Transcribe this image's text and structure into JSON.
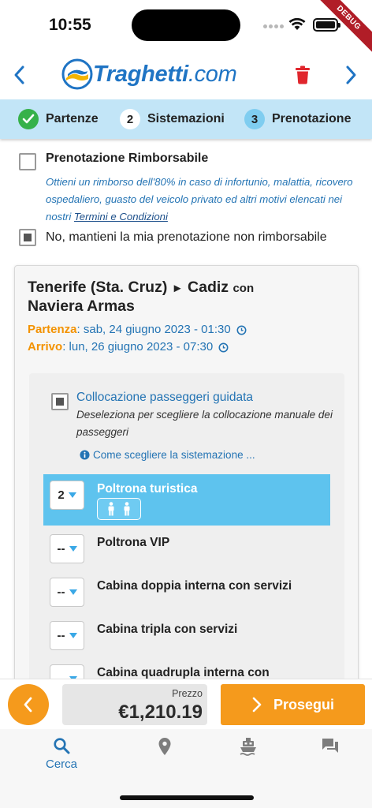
{
  "status_bar": {
    "time": "10:55",
    "debug_label": "DEBUG"
  },
  "header": {
    "logo_main": "Traghetti",
    "logo_suffix": ".com",
    "icons": [
      "chevron-left-icon",
      "trash-icon",
      "chevron-right-icon"
    ],
    "accent_color": "#1f74c4",
    "trash_color": "#e0262d"
  },
  "steps": [
    {
      "number": "",
      "label": "Partenze",
      "state": "done"
    },
    {
      "number": "2",
      "label": "Sistemazioni",
      "state": "visited"
    },
    {
      "number": "3",
      "label": "Prenotazione",
      "state": "active"
    }
  ],
  "refund": {
    "title": "Prenotazione Rimborsabile",
    "description": "Ottieni un rimborso dell'80% in caso di infortunio, malattia, ricovero ospedaliero, guasto del veicolo privato ed altri motivi elencati nei nostri ",
    "link": "Termini e Condizioni",
    "checked": false
  },
  "no_refund": {
    "label": "No, mantieni la mia prenotazione non rimborsabile",
    "checked": true
  },
  "trip": {
    "origin": "Tenerife (Sta. Cruz)",
    "arrow": "►",
    "destination": "Cadiz",
    "with_word": "con",
    "operator": "Naviera Armas",
    "departure_label": "Partenza",
    "departure_value": ": sab, 24 giugno 2023 - 01:30",
    "arrival_label": "Arrivo",
    "arrival_value": ": lun, 26 giugno 2023 - 07:30"
  },
  "guided": {
    "title": "Collocazione passeggeri guidata",
    "description": "Deseleziona per scegliere la collocazione manuale dei passeggeri",
    "checked": true,
    "howto_link": "Come scegliere la sistemazione ..."
  },
  "accommodations": [
    {
      "qty": "2",
      "name": "Poltrona turistica",
      "selected": true,
      "passenger_count": 2
    },
    {
      "qty": "--",
      "name": "Poltrona VIP",
      "selected": false
    },
    {
      "qty": "--",
      "name": "Cabina doppia interna con servizi",
      "selected": false
    },
    {
      "qty": "--",
      "name": "Cabina tripla con servizi",
      "selected": false
    },
    {
      "qty": "--",
      "name": "Cabina quadrupla interna con",
      "selected": false
    }
  ],
  "footer": {
    "price_label": "Prezzo",
    "price_value": "€1,210.19",
    "continue_label": "Prosegui",
    "action_color": "#f59a1c"
  },
  "tabs": [
    {
      "label": "Cerca",
      "icon": "search-icon"
    },
    {
      "label": "",
      "icon": "location-pin-icon"
    },
    {
      "label": "",
      "icon": "ferry-icon"
    },
    {
      "label": "",
      "icon": "chat-icon"
    }
  ]
}
